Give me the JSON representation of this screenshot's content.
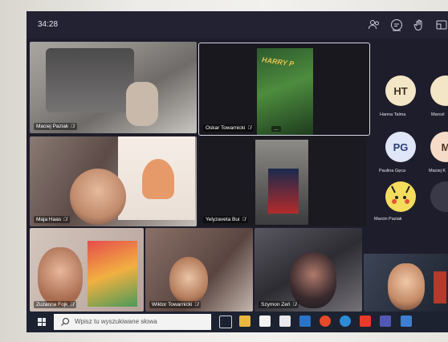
{
  "meeting": {
    "timer": "34:28",
    "toolbar_icons": [
      "people-icon",
      "chat-icon",
      "raise-hand-icon",
      "view-icon"
    ]
  },
  "participants": [
    {
      "name": "Maciej Paziak",
      "slot": "tile-1"
    },
    {
      "name": "Oskar Towarnicki",
      "slot": "tile-2"
    },
    {
      "name": "Maja Haas",
      "slot": "tile-3"
    },
    {
      "name": "Yelyzaveta Bui",
      "slot": "tile-4"
    },
    {
      "name": "Zuzanna Fojk",
      "slot": "tile-5"
    },
    {
      "name": "Wiktor Towarnicki",
      "slot": "tile-6"
    },
    {
      "name": "Szymon Zeń",
      "slot": "tile-7"
    }
  ],
  "more_options": "...",
  "sidebar": {
    "avatars": [
      {
        "initials": "HT",
        "name": "Hanna Talma",
        "bg": "#f3e6c6",
        "fg": "#3c3420"
      },
      {
        "initials": "PG",
        "name": "Paulina Gęca",
        "bg": "#dfe6f7",
        "fg": "#2c3e78"
      },
      {
        "initials": "",
        "name": "Marcin Paziak",
        "bg": "#f4dd5c",
        "fg": "#000"
      }
    ],
    "partial": [
      {
        "initials": "",
        "name": "Marcel"
      },
      {
        "initials": "M",
        "name": "Maciej K"
      }
    ]
  },
  "taskbar": {
    "search_placeholder": "Wpisz tu wyszukiwane słowa"
  }
}
